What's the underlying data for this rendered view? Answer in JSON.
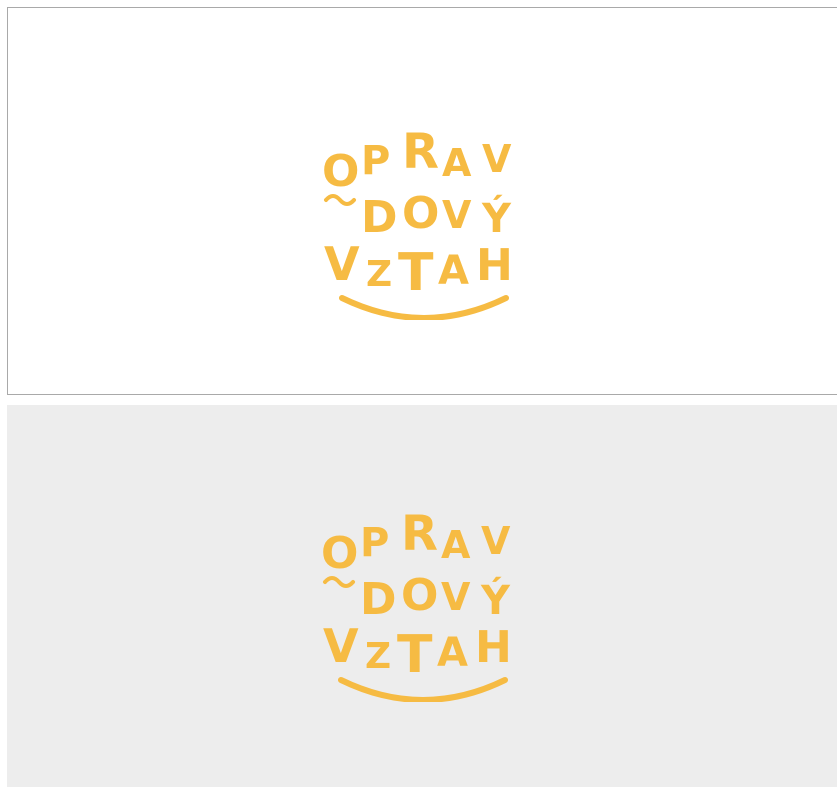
{
  "brand_color": "#f6bb43",
  "backgrounds": {
    "light": "#ffffff",
    "gray": "#ededed"
  },
  "logo": {
    "line1": [
      "O",
      "P",
      "R",
      "A",
      "V"
    ],
    "line2": [
      "D",
      "O",
      "V",
      "Ý"
    ],
    "line3": [
      "V",
      "Z",
      "T",
      "A",
      "H"
    ]
  },
  "panels": [
    {
      "variant": "on-white"
    },
    {
      "variant": "on-gray"
    }
  ]
}
